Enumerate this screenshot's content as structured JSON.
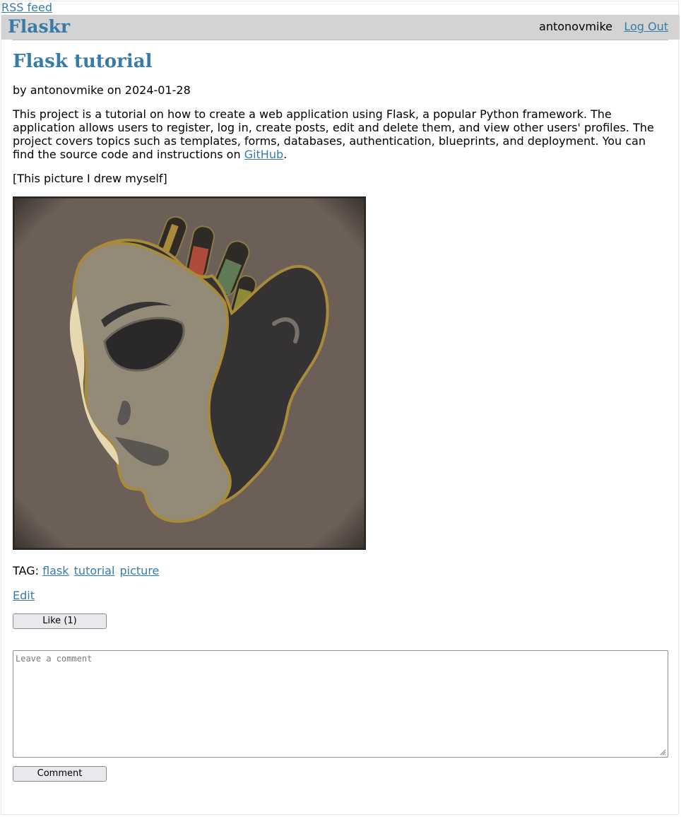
{
  "header": {
    "rss_label": "RSS feed",
    "brand": "Flaskr",
    "username": "antonovmike",
    "logout_label": "Log Out"
  },
  "post": {
    "title": "Flask tutorial",
    "byline": "by antonovmike on 2024-01-28",
    "body_text": "This project is a tutorial on how to create a web application using Flask, a popular Python framework. The application allows users to register, log in, create posts, edit and delete them, and view other users' profiles. The project covers topics such as templates, forms, databases, authentication, blueprints, and deployment. You can find the source code and instructions on ",
    "body_link": "GitHub",
    "body_end": ".",
    "caption": "[This picture I drew myself]",
    "image_icon": "flask-head-illustration",
    "tag_label": "TAG:",
    "tags": [
      "flask",
      "tutorial",
      "picture"
    ],
    "edit_label": "Edit",
    "like_label": "Like (1)"
  },
  "comment": {
    "placeholder": "Leave a comment",
    "submit_label": "Comment"
  },
  "colors": {
    "accent": "#377ba8",
    "nav_bg": "#d3d3d3",
    "image_bg": "#6b5f57"
  }
}
